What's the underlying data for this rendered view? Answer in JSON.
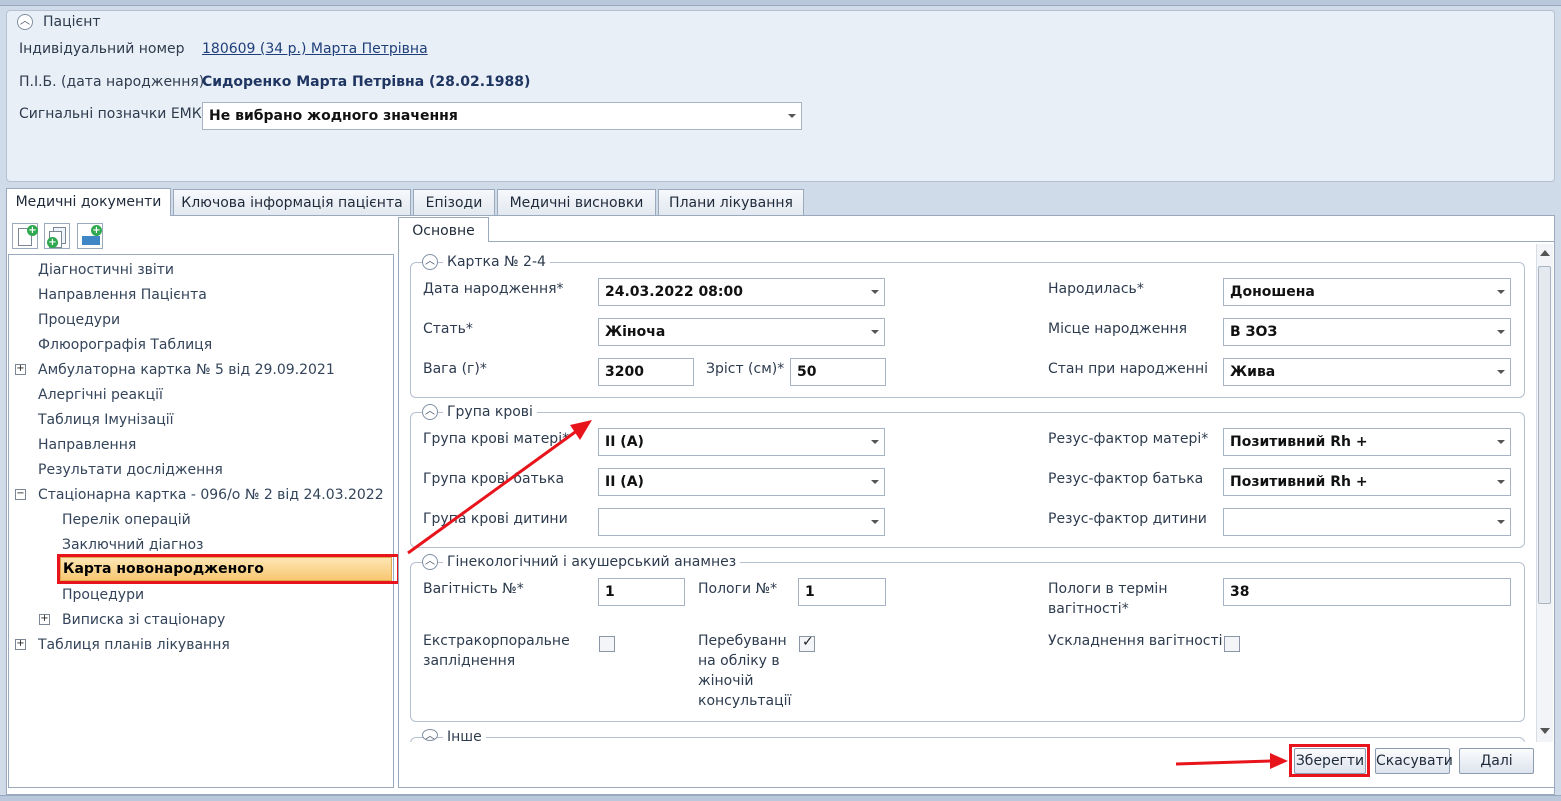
{
  "patient": {
    "section_title": "Пацієнт",
    "id_label": "Індивідуальний номер",
    "id_value": "180609 (34 р.) Марта Петрівна",
    "name_label": "П.І.Б. (дата народження)",
    "name_value": "Сидоренко Марта Петрівна (28.02.1988)",
    "signals_label": "Сигнальні позначки ЕМК",
    "signals_value": "Не вибрано жодного значення"
  },
  "tabs": [
    "Медичні документи",
    "Ключова інформація пацієнта",
    "Епізоди",
    "Медичні висновки",
    "Плани лікування"
  ],
  "toolbar": {
    "icons": [
      "add-document-icon",
      "copy-document-icon",
      "add-record-icon"
    ]
  },
  "tree": {
    "items": [
      "Діагностичні звіти",
      "Направлення Пацієнта",
      "Процедури",
      "Флюорографія Таблиця",
      "Амбулаторна картка № 5 від 29.09.2021",
      "Алергічні реакції",
      "Таблиця Імунізації",
      "Направлення",
      "Результати дослідження",
      "Стаціонарна картка - 096/о № 2 від 24.03.2022",
      "Перелік операцій",
      "Заключний діагноз",
      "Карта новонародженого",
      "Процедури",
      "Виписка зі стаціонару",
      "Таблиця планів лікування"
    ],
    "selected": "Карта новонародженого"
  },
  "inner_tab": "Основне",
  "card": {
    "title": "Картка № 2-4",
    "birth_date_label": "Дата народження*",
    "birth_date_value": "24.03.2022 08:00",
    "born_label": "Народилась*",
    "born_value": "Доношена",
    "sex_label": "Стать*",
    "sex_value": "Жіноча",
    "place_label": "Місце народження",
    "place_value": "В ЗОЗ",
    "weight_label": "Вага (г)*",
    "weight_value": "3200",
    "height_label": "Зріст (см)*",
    "height_value": "50",
    "state_label": "Стан при народженні",
    "state_value": "Жива"
  },
  "blood": {
    "title": "Група крові",
    "mother_label": "Група крові матері*",
    "mother_value": "II (A)",
    "rh_mother_label": "Резус-фактор матері*",
    "rh_mother_value": "Позитивний Rh +",
    "father_label": "Група крові батька",
    "father_value": "II (A)",
    "rh_father_label": "Резус-фактор батька",
    "rh_father_value": "Позитивний Rh +",
    "child_label": "Група крові дитини",
    "child_value": "",
    "rh_child_label": "Резус-фактор дитини",
    "rh_child_value": ""
  },
  "anamnesis": {
    "title": "Гінекологічний і акушерський анамнез",
    "pregnancy_label": "Вагітність №*",
    "pregnancy_value": "1",
    "births_label": "Пологи №*",
    "births_value": "1",
    "term_label_1": "Пологи в термін",
    "term_label_2": "вагітності*",
    "term_value": "38",
    "eco_label_1": "Екстракорпоральне",
    "eco_label_2": "запліднення",
    "eco_checked": false,
    "registered_label_1": "Перебуванн:",
    "registered_label_2": "на обліку в",
    "registered_label_3": "жіночій",
    "registered_label_4": "консультації",
    "registered_checked": true,
    "complications_label": "Ускладнення вагітності",
    "complications_checked": false
  },
  "other": {
    "title": "Інше"
  },
  "buttons": {
    "save": "Зберегти",
    "cancel": "Скасувати",
    "next": "Далі"
  },
  "annotation_color": "#e8141c"
}
